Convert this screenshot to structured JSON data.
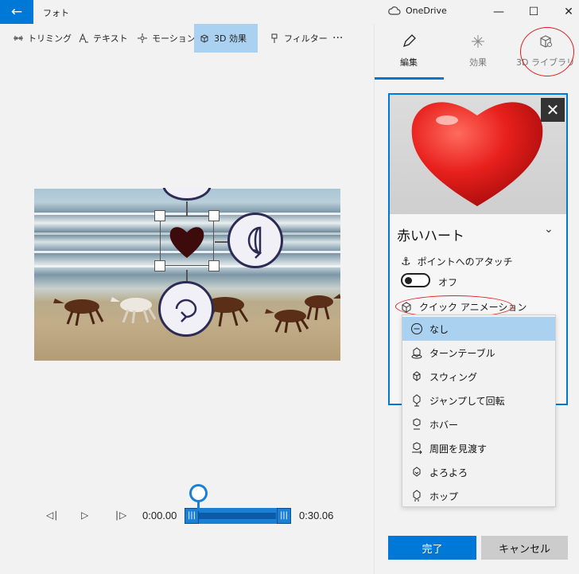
{
  "app": {
    "title": "フォト",
    "onedrive_label": "OneDrive"
  },
  "toolbar": {
    "trim": "トリミング",
    "text": "テキスト",
    "motion": "モーション",
    "effects_3d": "3D 効果",
    "filter": "フィルター",
    "more": "···"
  },
  "timeline": {
    "start_time": "0:00.00",
    "end_time": "0:30.06"
  },
  "panel": {
    "tabs": [
      {
        "label": "編集",
        "icon": "pencil-icon",
        "active": true
      },
      {
        "label": "効果",
        "icon": "sparkle-icon",
        "active": false
      },
      {
        "label": "3D ライブラリ",
        "icon": "cube-icon",
        "active": false
      }
    ],
    "object_name": "赤いハート",
    "attach_label": "ポイントへのアタッチ",
    "toggle_state": "オフ",
    "quick_anim_label": "クイック アニメーション",
    "animations": [
      {
        "label": "なし",
        "icon": "minus-circle-icon",
        "selected": true
      },
      {
        "label": "ターンテーブル",
        "icon": "turntable-icon",
        "selected": false
      },
      {
        "label": "スウィング",
        "icon": "swing-icon",
        "selected": false
      },
      {
        "label": "ジャンプして回転",
        "icon": "jump-spin-icon",
        "selected": false
      },
      {
        "label": "ホバー",
        "icon": "hover-icon",
        "selected": false
      },
      {
        "label": "周囲を見渡す",
        "icon": "look-around-icon",
        "selected": false
      },
      {
        "label": "よろよろ",
        "icon": "wobble-icon",
        "selected": false
      },
      {
        "label": "ホップ",
        "icon": "hop-icon",
        "selected": false
      }
    ],
    "done_label": "完了",
    "cancel_label": "キャンセル"
  },
  "colors": {
    "accent": "#0078d7",
    "selection": "#abd1f1",
    "annotation": "#e31b1b",
    "heart": "#e8201c"
  }
}
